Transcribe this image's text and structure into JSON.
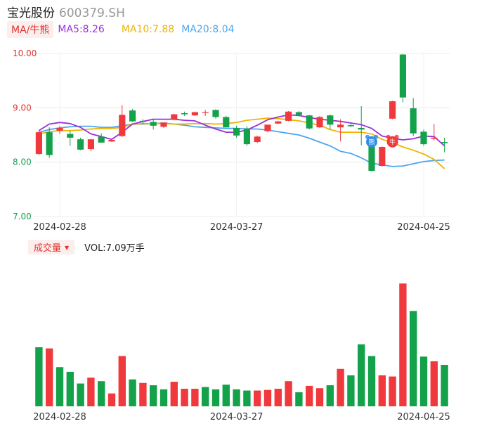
{
  "header": {
    "name": "宝光股份",
    "code": "600379.SH"
  },
  "ma_legend": {
    "mode": "MA/牛熊",
    "ma5": "MA5:8.26",
    "ma10": "MA10:7.88",
    "ma20": "MA20:8.04"
  },
  "vol_legend": {
    "mode": "成交量",
    "value": "VOL:7.09万手"
  },
  "colors": {
    "up": "#f0393d",
    "down": "#13a14a",
    "ma5": "#9b30d9",
    "ma10": "#f0b400",
    "ma20": "#4da6ee",
    "axis_red": "#e0322d",
    "axis_green": "#13a14a"
  },
  "icons": {
    "bear_marker": "bear-icon",
    "bull_marker": "bull-icon",
    "bear_glyph": "熊",
    "bull_glyph": "牛"
  },
  "chart_data": [
    {
      "type": "candlestick",
      "ylim": [
        7.0,
        10.0
      ],
      "y_ticks": [
        "10.00",
        "9.00",
        "8.00",
        "7.00"
      ],
      "x_ticks": [
        {
          "label": "2024-02-28",
          "index": 2
        },
        {
          "label": "2024-03-27",
          "index": 19
        },
        {
          "label": "2024-04-25",
          "index": 37
        }
      ],
      "grid": true,
      "candles": [
        {
          "o": 8.15,
          "h": 8.58,
          "l": 8.13,
          "c": 8.55
        },
        {
          "o": 8.55,
          "h": 8.64,
          "l": 8.08,
          "c": 8.13
        },
        {
          "o": 8.58,
          "h": 8.67,
          "l": 8.52,
          "c": 8.63
        },
        {
          "o": 8.52,
          "h": 8.58,
          "l": 8.3,
          "c": 8.45
        },
        {
          "o": 8.42,
          "h": 8.45,
          "l": 8.22,
          "c": 8.23
        },
        {
          "o": 8.24,
          "h": 8.43,
          "l": 8.2,
          "c": 8.42
        },
        {
          "o": 8.47,
          "h": 8.53,
          "l": 8.36,
          "c": 8.36
        },
        {
          "o": 8.38,
          "h": 8.43,
          "l": 8.37,
          "c": 8.41
        },
        {
          "o": 8.48,
          "h": 9.05,
          "l": 8.46,
          "c": 8.87
        },
        {
          "o": 8.95,
          "h": 8.98,
          "l": 8.74,
          "c": 8.75
        },
        {
          "o": 8.76,
          "h": 8.79,
          "l": 8.7,
          "c": 8.74
        },
        {
          "o": 8.74,
          "h": 8.8,
          "l": 8.6,
          "c": 8.67
        },
        {
          "o": 8.65,
          "h": 8.73,
          "l": 8.63,
          "c": 8.73
        },
        {
          "o": 8.78,
          "h": 8.89,
          "l": 8.77,
          "c": 8.88
        },
        {
          "o": 8.9,
          "h": 8.93,
          "l": 8.85,
          "c": 8.88
        },
        {
          "o": 8.86,
          "h": 8.93,
          "l": 8.85,
          "c": 8.92
        },
        {
          "o": 8.92,
          "h": 8.96,
          "l": 8.85,
          "c": 8.92
        },
        {
          "o": 8.96,
          "h": 8.97,
          "l": 8.8,
          "c": 8.83
        },
        {
          "o": 8.83,
          "h": 8.85,
          "l": 8.64,
          "c": 8.64
        },
        {
          "o": 8.63,
          "h": 8.67,
          "l": 8.45,
          "c": 8.49
        },
        {
          "o": 8.62,
          "h": 8.66,
          "l": 8.3,
          "c": 8.33
        },
        {
          "o": 8.37,
          "h": 8.49,
          "l": 8.35,
          "c": 8.47
        },
        {
          "o": 8.57,
          "h": 8.69,
          "l": 8.55,
          "c": 8.69
        },
        {
          "o": 8.71,
          "h": 8.76,
          "l": 8.7,
          "c": 8.75
        },
        {
          "o": 8.76,
          "h": 8.94,
          "l": 8.75,
          "c": 8.93
        },
        {
          "o": 8.92,
          "h": 8.94,
          "l": 8.84,
          "c": 8.87
        },
        {
          "o": 8.86,
          "h": 8.87,
          "l": 8.6,
          "c": 8.62
        },
        {
          "o": 8.64,
          "h": 8.85,
          "l": 8.63,
          "c": 8.83
        },
        {
          "o": 8.86,
          "h": 8.88,
          "l": 8.6,
          "c": 8.69
        },
        {
          "o": 8.64,
          "h": 8.79,
          "l": 8.38,
          "c": 8.69
        },
        {
          "o": 8.68,
          "h": 8.73,
          "l": 8.65,
          "c": 8.66
        },
        {
          "o": 8.63,
          "h": 9.03,
          "l": 8.31,
          "c": 8.6
        },
        {
          "o": 8.31,
          "h": 8.32,
          "l": 7.83,
          "c": 7.84
        },
        {
          "o": 7.93,
          "h": 8.29,
          "l": 7.92,
          "c": 8.28
        },
        {
          "o": 8.8,
          "h": 9.13,
          "l": 8.79,
          "c": 9.12
        },
        {
          "o": 9.98,
          "h": 9.99,
          "l": 9.1,
          "c": 9.19
        },
        {
          "o": 8.99,
          "h": 9.18,
          "l": 8.48,
          "c": 8.53
        },
        {
          "o": 8.56,
          "h": 8.6,
          "l": 8.3,
          "c": 8.33
        },
        {
          "o": 8.43,
          "h": 8.7,
          "l": 8.4,
          "c": 8.45
        },
        {
          "o": 8.37,
          "h": 8.45,
          "l": 8.18,
          "c": 8.35
        }
      ],
      "ma5": [
        8.58,
        8.7,
        8.73,
        8.71,
        8.64,
        8.52,
        8.47,
        8.42,
        8.55,
        8.7,
        8.75,
        8.79,
        8.79,
        8.79,
        8.77,
        8.76,
        8.68,
        8.61,
        8.55,
        8.55,
        8.59,
        8.68,
        8.78,
        8.83,
        8.87,
        8.86,
        8.82,
        8.79,
        8.77,
        8.75,
        8.72,
        8.69,
        8.62,
        8.48,
        8.44,
        8.41,
        8.43,
        8.48,
        8.47,
        8.3
      ],
      "ma10": [
        8.52,
        8.56,
        8.58,
        8.58,
        8.59,
        8.61,
        8.62,
        8.62,
        8.64,
        8.7,
        8.71,
        8.71,
        8.71,
        8.7,
        8.7,
        8.71,
        8.71,
        8.7,
        8.71,
        8.73,
        8.77,
        8.79,
        8.81,
        8.8,
        8.78,
        8.76,
        8.72,
        8.68,
        8.6,
        8.55,
        8.55,
        8.55,
        8.52,
        8.42,
        8.36,
        8.28,
        8.22,
        8.15,
        8.05,
        7.88
      ],
      "ma20": [
        8.55,
        8.6,
        8.63,
        8.65,
        8.66,
        8.66,
        8.64,
        8.64,
        8.67,
        8.7,
        8.7,
        8.71,
        8.72,
        8.7,
        8.68,
        8.65,
        8.64,
        8.63,
        8.62,
        8.62,
        8.61,
        8.61,
        8.59,
        8.56,
        8.53,
        8.5,
        8.44,
        8.37,
        8.3,
        8.2,
        8.16,
        8.08,
        7.98,
        7.95,
        7.92,
        7.93,
        7.97,
        8.01,
        8.03,
        8.04
      ],
      "markers": [
        {
          "index": 32,
          "kind": "bear",
          "value": 8.4
        },
        {
          "index": 34,
          "kind": "bull",
          "value": 8.4
        }
      ]
    },
    {
      "type": "bar",
      "name": "成交量",
      "unit": "万手",
      "x_ticks": [
        {
          "label": "2024-02-28",
          "index": 2
        },
        {
          "label": "2024-03-27",
          "index": 19
        },
        {
          "label": "2024-04-25",
          "index": 37
        }
      ],
      "ylim": [
        0,
        25
      ],
      "values": [
        10.1,
        9.9,
        6.7,
        5.9,
        3.9,
        4.9,
        4.3,
        2.2,
        8.6,
        4.6,
        4.0,
        3.6,
        2.9,
        4.2,
        3.0,
        3.0,
        3.3,
        2.9,
        3.7,
        2.9,
        2.7,
        2.7,
        2.8,
        3.0,
        4.3,
        2.4,
        3.5,
        3.1,
        3.6,
        6.4,
        5.3,
        10.6,
        8.6,
        5.3,
        5.1,
        21.0,
        16.3,
        8.5,
        7.7,
        7.09
      ],
      "up": [
        false,
        true,
        false,
        false,
        false,
        true,
        false,
        true,
        true,
        false,
        true,
        false,
        false,
        true,
        true,
        true,
        false,
        false,
        false,
        false,
        false,
        true,
        true,
        true,
        true,
        false,
        true,
        true,
        false,
        true,
        false,
        false,
        false,
        true,
        true,
        true,
        false,
        false,
        true,
        false
      ]
    }
  ]
}
